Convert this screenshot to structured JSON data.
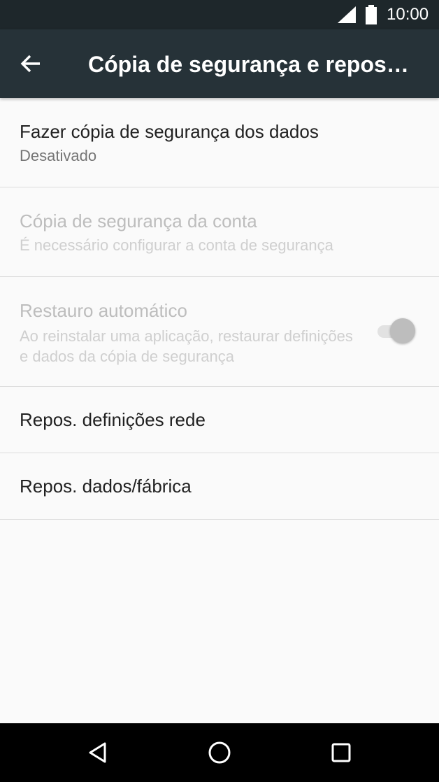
{
  "status_bar": {
    "time": "10:00",
    "icons": [
      "signal-icon",
      "battery-icon"
    ]
  },
  "app_bar": {
    "back_icon": "back-arrow-icon",
    "title": "Cópia de segurança e repos…"
  },
  "settings": {
    "items": [
      {
        "title": "Fazer cópia de segurança dos dados",
        "summary": "Desativado"
      },
      {
        "title": "Cópia de segurança da conta",
        "summary": "É necessário configurar a conta de segurança"
      },
      {
        "title": "Restauro automático",
        "summary": "Ao reinstalar uma aplicação, restaurar definições e dados da cópia de segurança"
      },
      {
        "title": "Repos. definições rede"
      },
      {
        "title": "Repos. dados/fábrica"
      }
    ]
  },
  "nav_bar": {
    "buttons": [
      "nav-back-icon",
      "nav-home-icon",
      "nav-recent-apps-icon"
    ]
  },
  "colors": {
    "status_bar": "#1e272b",
    "app_bar": "#263238",
    "background": "#fafafa",
    "primary_text": "#212121",
    "secondary_text": "#757575",
    "disabled_text": "#bdbdbd"
  }
}
